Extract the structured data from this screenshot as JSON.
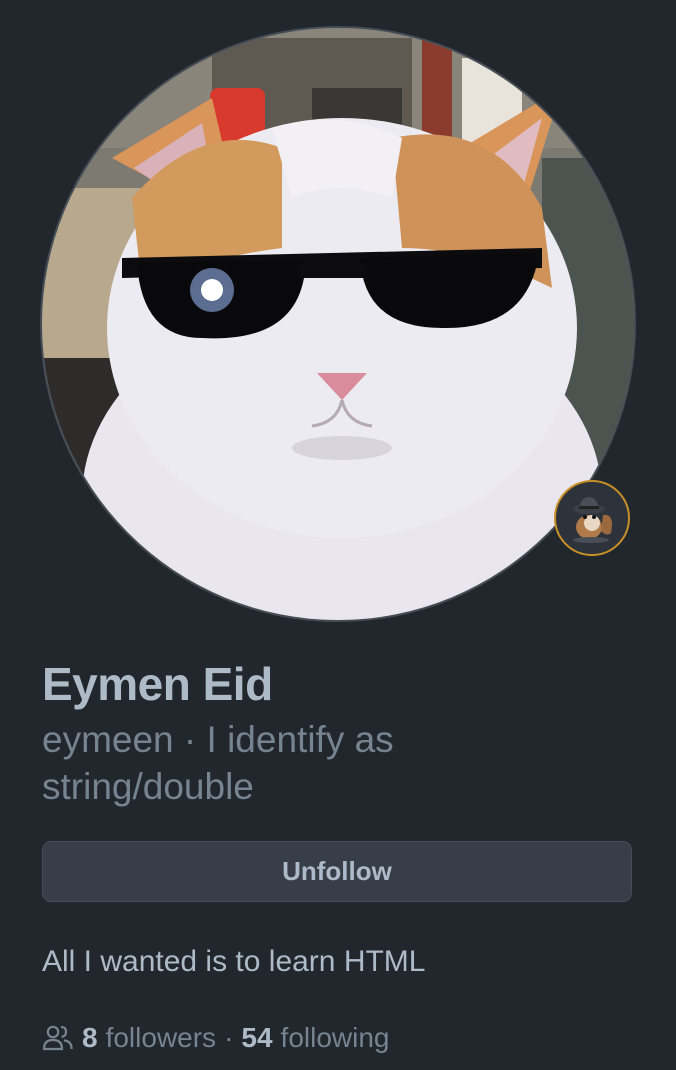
{
  "profile": {
    "full_name": "Eymen Eid",
    "username": "eymeen",
    "pronoun_separator": "·",
    "pronouns": "I identify as string/double",
    "bio": "All I wanted is to learn HTML",
    "avatar_icon": "cat-with-sunglasses",
    "status_icon": "detective-squirrel"
  },
  "actions": {
    "unfollow_label": "Unfollow"
  },
  "social": {
    "followers_count": "8",
    "followers_label": "followers",
    "separator": "·",
    "following_count": "54",
    "following_label": "following"
  },
  "colors": {
    "background": "#22272e",
    "text_primary": "#adbac7",
    "text_muted": "#768390",
    "button_bg": "#373e47",
    "border": "#444c56",
    "status_ring": "#c69026"
  }
}
